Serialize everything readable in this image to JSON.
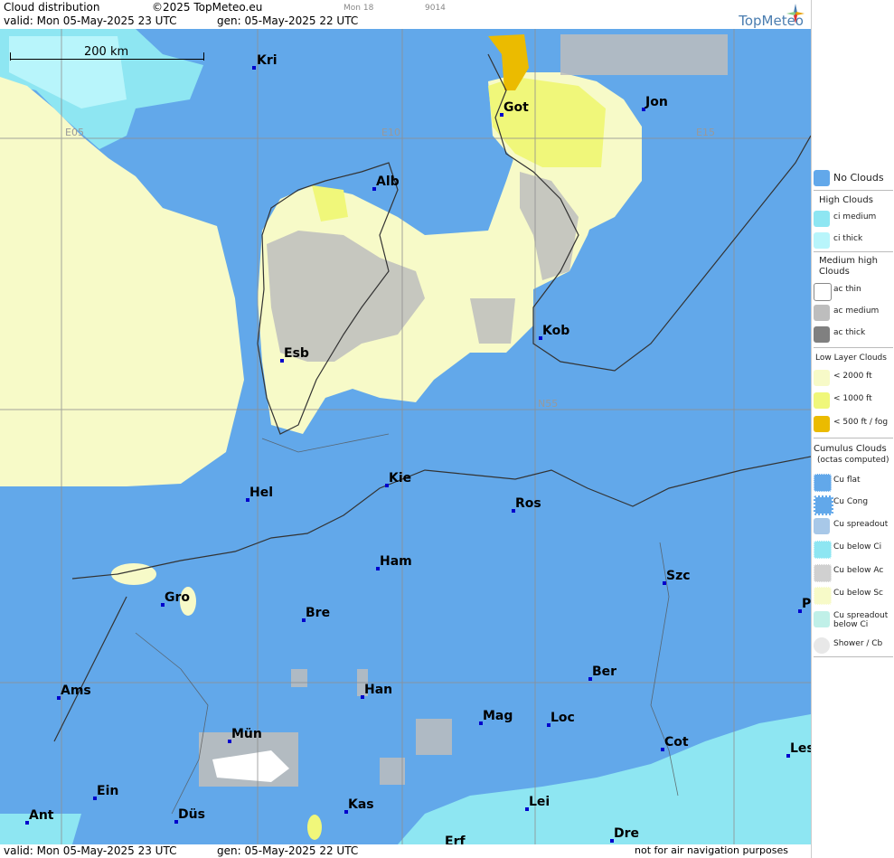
{
  "header": {
    "title": "Cloud distribution",
    "copyright": "©2025 TopMeteo.eu",
    "run": "Mon 18",
    "code": "9014",
    "valid": "valid:  Mon  05-May-2025  23 UTC",
    "gen": "gen: 05-May-2025 22 UTC",
    "brand": "TopMeteo"
  },
  "footer": {
    "valid": "valid:  Mon  05-May-2025  23 UTC",
    "gen": "gen: 05-May-2025 22 UTC",
    "disclaimer": "not for air navigation purposes"
  },
  "scale": {
    "label": "200 km"
  },
  "grid_labels": {
    "e05": "E05",
    "e10": "E10",
    "e15": "E15",
    "n55": "N55"
  },
  "cities": [
    {
      "name": "Kri"
    },
    {
      "name": "Got"
    },
    {
      "name": "Jon"
    },
    {
      "name": "Alb"
    },
    {
      "name": "Kob"
    },
    {
      "name": "Esb"
    },
    {
      "name": "Kie"
    },
    {
      "name": "Hel"
    },
    {
      "name": "Ros"
    },
    {
      "name": "Ham"
    },
    {
      "name": "Szc"
    },
    {
      "name": "Gro"
    },
    {
      "name": "Bre"
    },
    {
      "name": "P"
    },
    {
      "name": "Ber"
    },
    {
      "name": "Ams"
    },
    {
      "name": "Han"
    },
    {
      "name": "Mag"
    },
    {
      "name": "Loc"
    },
    {
      "name": "Mün"
    },
    {
      "name": "Cot"
    },
    {
      "name": "Les"
    },
    {
      "name": "Ein"
    },
    {
      "name": "Kas"
    },
    {
      "name": "Lei"
    },
    {
      "name": "Ant"
    },
    {
      "name": "Düs"
    },
    {
      "name": "Dre"
    },
    {
      "name": "Erf"
    }
  ],
  "legend": {
    "no_clouds": "No Clouds",
    "high_title": "High Clouds",
    "ci_medium": "ci medium",
    "ci_thick": "ci thick",
    "medium_title": "Medium high Clouds",
    "ac_thin": "ac thin",
    "ac_medium": "ac medium",
    "ac_thick": "ac thick",
    "low_title": "Low Layer Clouds",
    "low_2000": "< 2000 ft",
    "low_1000": "< 1000 ft",
    "low_500": "< 500 ft / fog",
    "cu_title": "Cumulus Clouds",
    "cu_sub": "(octas computed)",
    "cu_flat": "Cu flat",
    "cu_cong": "Cu Cong",
    "cu_spreadout": "Cu spreadout",
    "cu_below_ci": "Cu below Ci",
    "cu_below_ac": "Cu below Ac",
    "cu_below_sc": "Cu below Sc",
    "cu_spread_ci": "Cu spreadout below Ci",
    "shower": "Shower / Cb"
  },
  "colors": {
    "no_clouds": "#62a8ea",
    "ci_medium": "#8ee6f2",
    "ci_thick": "#b8f5fb",
    "ac_thin": "#ffffff",
    "ac_medium": "#bdbdbd",
    "ac_thick": "#808080",
    "low_2000": "#f7fac8",
    "low_1000": "#f0f77a",
    "low_500": "#ebbb00"
  }
}
